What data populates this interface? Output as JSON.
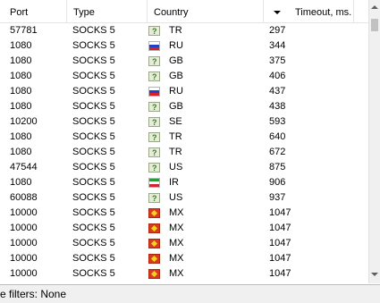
{
  "header": {
    "port": "Port",
    "type": "Type",
    "country": "Country",
    "timeout": "Timeout, ms."
  },
  "rows": [
    {
      "port": "57781",
      "type": "SOCKS 5",
      "flag": "unknown-flag-icon",
      "country": "TR",
      "timeout": "297"
    },
    {
      "port": "1080",
      "type": "SOCKS 5",
      "flag": "russia-flag-icon",
      "country": "RU",
      "timeout": "344"
    },
    {
      "port": "1080",
      "type": "SOCKS 5",
      "flag": "unknown-flag-icon",
      "country": "GB",
      "timeout": "375"
    },
    {
      "port": "1080",
      "type": "SOCKS 5",
      "flag": "unknown-flag-icon",
      "country": "GB",
      "timeout": "406"
    },
    {
      "port": "1080",
      "type": "SOCKS 5",
      "flag": "russia-flag-icon",
      "country": "RU",
      "timeout": "437"
    },
    {
      "port": "1080",
      "type": "SOCKS 5",
      "flag": "unknown-flag-icon",
      "country": "GB",
      "timeout": "438"
    },
    {
      "port": "10200",
      "type": "SOCKS 5",
      "flag": "unknown-flag-icon",
      "country": "SE",
      "timeout": "593"
    },
    {
      "port": "1080",
      "type": "SOCKS 5",
      "flag": "unknown-flag-icon",
      "country": "TR",
      "timeout": "640"
    },
    {
      "port": "1080",
      "type": "SOCKS 5",
      "flag": "unknown-flag-icon",
      "country": "TR",
      "timeout": "672"
    },
    {
      "port": "47544",
      "type": "SOCKS 5",
      "flag": "unknown-flag-icon",
      "country": "US",
      "timeout": "875"
    },
    {
      "port": "1080",
      "type": "SOCKS 5",
      "flag": "iran-flag-icon",
      "country": "IR",
      "timeout": "906"
    },
    {
      "port": "60088",
      "type": "SOCKS 5",
      "flag": "unknown-flag-icon",
      "country": "US",
      "timeout": "937"
    },
    {
      "port": "10000",
      "type": "SOCKS 5",
      "flag": "mexico-flag-icon",
      "country": "MX",
      "timeout": "1047"
    },
    {
      "port": "10000",
      "type": "SOCKS 5",
      "flag": "mexico-flag-icon",
      "country": "MX",
      "timeout": "1047"
    },
    {
      "port": "10000",
      "type": "SOCKS 5",
      "flag": "mexico-flag-icon",
      "country": "MX",
      "timeout": "1047"
    },
    {
      "port": "10000",
      "type": "SOCKS 5",
      "flag": "mexico-flag-icon",
      "country": "MX",
      "timeout": "1047"
    },
    {
      "port": "10000",
      "type": "SOCKS 5",
      "flag": "mexico-flag-icon",
      "country": "MX",
      "timeout": "1047"
    }
  ],
  "status": {
    "text": "ve filters: None"
  },
  "icons": {
    "sort": "sort-descending-icon",
    "scroll_up": "scroll-up-arrow-icon",
    "scroll_down": "scroll-down-arrow-icon"
  }
}
